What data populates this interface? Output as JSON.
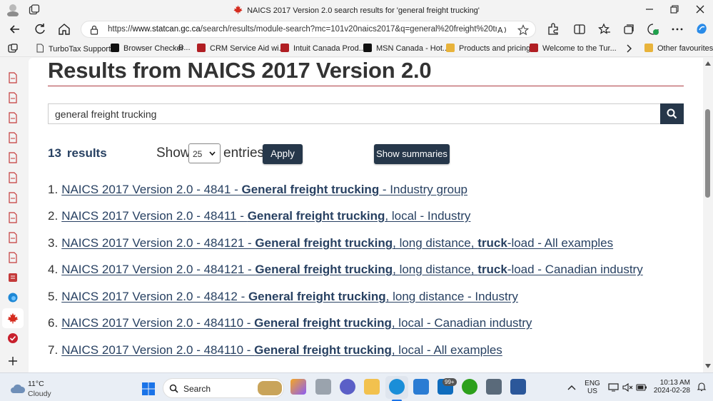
{
  "window": {
    "title": "NAICS 2017 Version 2.0 search results for 'general freight trucking'"
  },
  "address_bar": {
    "url_prefix": "https://",
    "url_domain": "www.statcan.gc.ca",
    "url_rest": "/search/results/module-search?mc=101v20naics2017&q=general%20freight%20tru..."
  },
  "favourites": [
    {
      "label": "TurboTax Support",
      "icon_color": "#555555"
    },
    {
      "label": "Browser Checker",
      "icon_color": "#111111"
    },
    {
      "label": "B...",
      "icon_color": ""
    },
    {
      "label": "CRM Service Aid wi...",
      "icon_color": "#b01e23"
    },
    {
      "label": "Intuit Canada Prod...",
      "icon_color": "#b01e23"
    },
    {
      "label": "MSN Canada - Hot...",
      "icon_color": "#111111"
    },
    {
      "label": "Products and pricing",
      "icon_color": "#e8b33b"
    },
    {
      "label": "Welcome to the Tur...",
      "icon_color": "#b01e23"
    },
    {
      "label": "Other favourites",
      "icon_color": "#e8b33b"
    }
  ],
  "page": {
    "heading": "Results from NAICS 2017 Version 2.0",
    "search_value": "general freight trucking",
    "result_count": "13",
    "result_count_label": "results",
    "show_label": "Show",
    "entries_selected": "25",
    "entries_label": "entries",
    "apply_label": "Apply",
    "summaries_label": "Show summaries",
    "results": [
      {
        "num": "1.",
        "pre": "NAICS 2017 Version 2.0 - 4841 - ",
        "bold": "General freight trucking",
        "post": " - Industry group"
      },
      {
        "num": "2.",
        "pre": "NAICS 2017 Version 2.0 - 48411 - ",
        "bold": "General freight trucking",
        "post": ", local - Industry"
      },
      {
        "num": "3.",
        "pre": "NAICS 2017 Version 2.0 - 484121 - ",
        "bold": "General freight trucking",
        "post": ", long distance, ",
        "bold2": "truck",
        "post2": "-load - All examples"
      },
      {
        "num": "4.",
        "pre": "NAICS 2017 Version 2.0 - 484121 - ",
        "bold": "General freight trucking",
        "post": ", long distance, ",
        "bold2": "truck",
        "post2": "-load - Canadian industry"
      },
      {
        "num": "5.",
        "pre": "NAICS 2017 Version 2.0 - 48412 - ",
        "bold": "General freight trucking",
        "post": ", long distance - Industry"
      },
      {
        "num": "6.",
        "pre": "NAICS 2017 Version 2.0 - 484110 - ",
        "bold": "General freight trucking",
        "post": ", local - Canadian industry"
      },
      {
        "num": "7.",
        "pre": "NAICS 2017 Version 2.0 - 484110 - ",
        "bold": "General freight trucking",
        "post": ", local - All examples"
      }
    ]
  },
  "taskbar": {
    "temperature": "11°C",
    "condition": "Cloudy",
    "search_label": "Search",
    "notification_badge": "99+",
    "lang_top": "ENG",
    "lang_bottom": "US",
    "time": "10:13 AM",
    "date": "2024-02-28"
  },
  "colors": {
    "gc_blue": "#284162",
    "gc_dark": "#26374a",
    "gc_red_rule": "#af3c43"
  }
}
